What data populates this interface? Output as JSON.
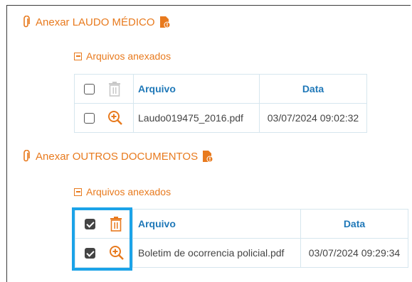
{
  "section1": {
    "link_label": "Anexar LAUDO MÉDICO",
    "files_toggle": "Arquivos anexados",
    "columns": [
      "Arquivo",
      "Data"
    ],
    "rows": [
      {
        "file": "Laudo019475_2016.pdf",
        "date": "03/07/2024 09:02:32",
        "checked": false
      }
    ],
    "delete_enabled": false
  },
  "section2": {
    "link_label": "Anexar OUTROS DOCUMENTOS",
    "files_toggle": "Arquivos anexados",
    "columns": [
      "Arquivo",
      "Data"
    ],
    "rows": [
      {
        "file": "Boletim de ocorrencia policial.pdf",
        "date": "03/07/2024 09:29:34",
        "checked": true
      }
    ],
    "header_checked": true,
    "delete_enabled": true
  },
  "colors": {
    "accent": "#e87a1e",
    "header_text": "#1f78b8",
    "highlight": "#1ba3e8",
    "disabled_icon": "#c8c8c8"
  },
  "icons": [
    "paperclip-icon",
    "document-alert-icon",
    "collapse-icon",
    "trash-icon",
    "zoom-in-icon",
    "checkbox"
  ]
}
